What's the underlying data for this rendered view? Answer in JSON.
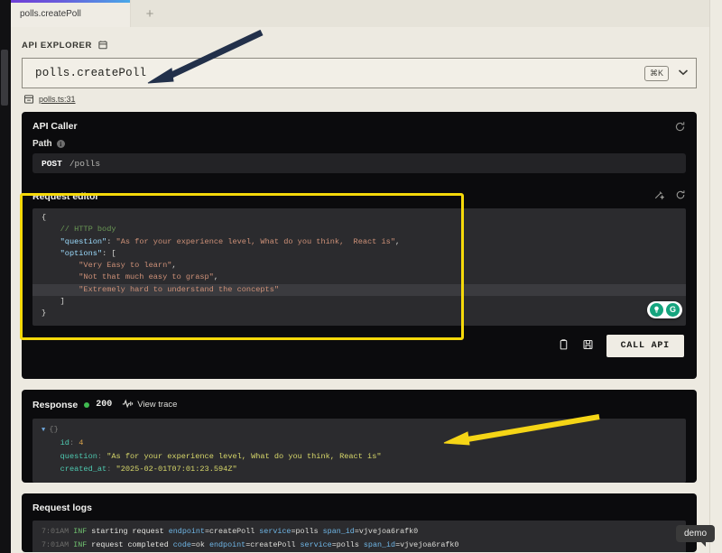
{
  "window": {
    "tabs": [
      {
        "label": "polls.createPoll",
        "active": true
      },
      {
        "label": "+",
        "active": false
      }
    ]
  },
  "explorer": {
    "heading": "API EXPLORER",
    "heading_icon": "clipboard-icon",
    "selected_endpoint": "polls.createPoll",
    "shortcut_badge": "⌘K",
    "chevron_icon": "chevron-down-icon",
    "source_link": "polls.ts:31",
    "source_icon": "file-code-icon"
  },
  "api_caller": {
    "title": "API Caller",
    "path_label": "Path",
    "path_info_icon": "info-icon",
    "reset_icon": "reset-icon",
    "method": "POST",
    "url": "/polls"
  },
  "request_editor": {
    "title": "Request editor",
    "magic_icon": "magic-wand-icon",
    "reset_icon": "reset-icon",
    "lines": [
      {
        "indent": 0,
        "parts": [
          {
            "cls": "c-punc",
            "t": "{"
          }
        ]
      },
      {
        "indent": 1,
        "parts": [
          {
            "cls": "c-comment",
            "t": "// HTTP body"
          }
        ]
      },
      {
        "indent": 1,
        "parts": [
          {
            "cls": "c-key",
            "t": "\"question\""
          },
          {
            "cls": "c-punc",
            "t": ": "
          },
          {
            "cls": "c-str",
            "t": "\"As for your experience level, What do you think,  React is\""
          },
          {
            "cls": "c-punc",
            "t": ","
          }
        ]
      },
      {
        "indent": 1,
        "parts": [
          {
            "cls": "c-key",
            "t": "\"options\""
          },
          {
            "cls": "c-punc",
            "t": ": ["
          }
        ]
      },
      {
        "indent": 2,
        "parts": [
          {
            "cls": "c-str",
            "t": "\"Very Easy to learn\""
          },
          {
            "cls": "c-punc",
            "t": ","
          }
        ]
      },
      {
        "indent": 2,
        "parts": [
          {
            "cls": "c-str",
            "t": "\"Not that much easy to grasp\""
          },
          {
            "cls": "c-punc",
            "t": ","
          }
        ]
      },
      {
        "indent": 2,
        "active": true,
        "parts": [
          {
            "cls": "c-str",
            "t": "\"Extremely hard to understand the concepts\""
          }
        ]
      },
      {
        "indent": 1,
        "parts": [
          {
            "cls": "c-punc",
            "t": "]"
          }
        ]
      },
      {
        "indent": 0,
        "parts": [
          {
            "cls": "c-punc",
            "t": "}"
          }
        ]
      }
    ],
    "grammarly": {
      "bulb_icon": "lightbulb-icon",
      "logo_icon": "grammarly-g-icon"
    }
  },
  "actions": {
    "copy_icon": "copy-icon",
    "save_icon": "save-icon",
    "call_api_label": "CALL API"
  },
  "response": {
    "title": "Response",
    "status_code": "200",
    "status_color": "#3fb950",
    "trace_label": "View trace",
    "trace_icon": "activity-icon",
    "toggle_icon": "triangle-down-icon",
    "lines": [
      {
        "indent": 0,
        "toggle": true,
        "parts": [
          {
            "cls": "r-brace",
            "t": "{}"
          }
        ]
      },
      {
        "indent": 1,
        "parts": [
          {
            "cls": "r-key",
            "t": "id"
          },
          {
            "cls": "r-brace",
            "t": ": "
          },
          {
            "cls": "r-num",
            "t": "4"
          }
        ]
      },
      {
        "indent": 1,
        "parts": [
          {
            "cls": "r-key",
            "t": "question"
          },
          {
            "cls": "r-brace",
            "t": ": "
          },
          {
            "cls": "r-str",
            "t": "\"As for your experience level, What do you think, React is\""
          }
        ]
      },
      {
        "indent": 1,
        "parts": [
          {
            "cls": "r-key",
            "t": "created_at"
          },
          {
            "cls": "r-brace",
            "t": ": "
          },
          {
            "cls": "r-str",
            "t": "\"2025-02-01T07:01:23.594Z\""
          }
        ]
      }
    ]
  },
  "request_logs": {
    "title": "Request logs",
    "lines": [
      {
        "parts": [
          {
            "cls": "l-time",
            "t": "7:01AM "
          },
          {
            "cls": "l-inf",
            "t": "INF "
          },
          {
            "cls": "l-msg",
            "t": "starting request "
          },
          {
            "cls": "l-kv",
            "t": "endpoint"
          },
          {
            "cls": "l-val",
            "t": "=createPoll "
          },
          {
            "cls": "l-kv",
            "t": "service"
          },
          {
            "cls": "l-val",
            "t": "=polls "
          },
          {
            "cls": "l-kv",
            "t": "span_id"
          },
          {
            "cls": "l-val",
            "t": "=vjvejoa6rafk0"
          }
        ]
      },
      {
        "parts": [
          {
            "cls": "l-time",
            "t": "7:01AM "
          },
          {
            "cls": "l-inf",
            "t": "INF "
          },
          {
            "cls": "l-msg",
            "t": "request completed "
          },
          {
            "cls": "l-kv",
            "t": "code"
          },
          {
            "cls": "l-val",
            "t": "=ok "
          },
          {
            "cls": "l-kv",
            "t": "endpoint"
          },
          {
            "cls": "l-val",
            "t": "=createPoll "
          },
          {
            "cls": "l-kv",
            "t": "service"
          },
          {
            "cls": "l-val",
            "t": "=polls "
          },
          {
            "cls": "l-kv",
            "t": "span_id"
          },
          {
            "cls": "l-val",
            "t": "=vjvejoa6rafk0"
          }
        ]
      }
    ]
  },
  "overlays": {
    "demo_tooltip": "demo",
    "arrow_navy_color": "#22304a",
    "arrow_yellow_color": "#f5d516",
    "highlight_color": "#f5d90a"
  }
}
